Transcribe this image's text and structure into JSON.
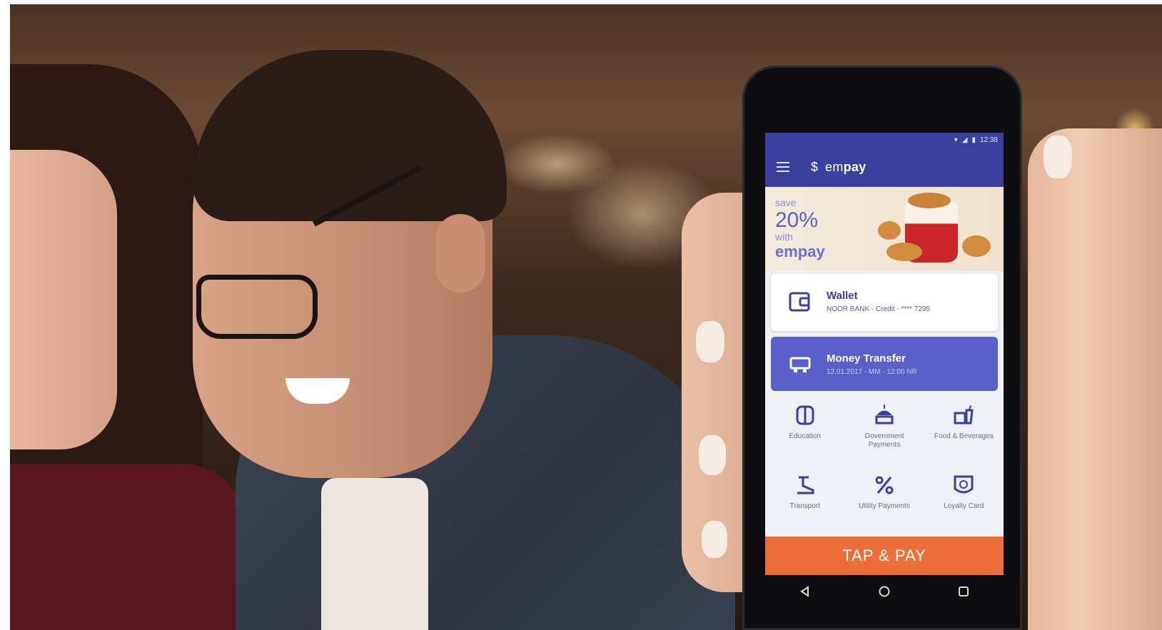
{
  "app": {
    "brand_prefix": "em",
    "brand_suffix": "pay",
    "status_time": "12:38"
  },
  "promo": {
    "line1": "save",
    "percent": "20%",
    "line3": "with",
    "brand": "empay"
  },
  "cards": [
    {
      "title": "Wallet",
      "subtitle": "NOOR BANK - Credit - **** 7295",
      "icon": "wallet-icon"
    },
    {
      "title": "Money Transfer",
      "subtitle": "12.01.2017 - MM - 12:00 NR",
      "icon": "money-transfer-icon"
    }
  ],
  "services": [
    {
      "label": "Education",
      "icon": "education-icon"
    },
    {
      "label": "Government Payments",
      "icon": "government-icon"
    },
    {
      "label": "Food & Beverages",
      "icon": "food-beverage-icon"
    },
    {
      "label": "Transport",
      "icon": "transport-icon"
    },
    {
      "label": "Utility Payments",
      "icon": "utility-icon"
    },
    {
      "label": "Loyalty Card",
      "icon": "loyalty-card-icon"
    }
  ],
  "action": {
    "tap_pay": "TAP & PAY"
  },
  "nav": [
    "back-icon",
    "home-icon",
    "recents-icon"
  ],
  "colors": {
    "primary": "#3b3f9e",
    "transfer_card": "#5b5fc8",
    "tap_pay": "#ec6f3a"
  }
}
